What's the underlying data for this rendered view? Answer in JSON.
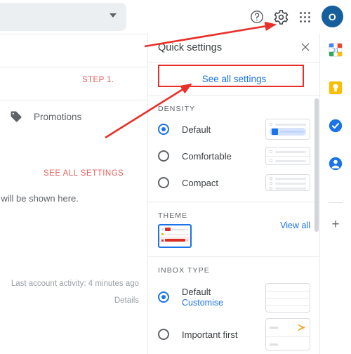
{
  "topbar": {
    "search_placeholder": "",
    "help_icon": "help-circle-icon",
    "settings_icon": "gear-icon",
    "apps_icon": "apps-grid-icon",
    "avatar_letter": "O",
    "avatar_color": "#15609c"
  },
  "left_pane": {
    "step_note": "STEP 1.",
    "tab_label": "Promotions",
    "tab_icon": "tag-icon",
    "see_all_note": "SEE ALL SETTINGS",
    "empty_note": "bs will be shown here.",
    "last_activity": "Last account activity: 4 minutes ago",
    "details_link": "Details"
  },
  "quick_settings": {
    "title": "Quick settings",
    "close_icon": "close-icon",
    "see_all_settings": "See all settings",
    "highlight_color": "#e8302a",
    "accent_color": "#1a73e8",
    "density": {
      "label": "DENSITY",
      "options": [
        {
          "label": "Default",
          "selected": true
        },
        {
          "label": "Comfortable",
          "selected": false
        },
        {
          "label": "Compact",
          "selected": false
        }
      ]
    },
    "theme": {
      "label": "THEME",
      "view_all": "View all"
    },
    "inbox_type": {
      "label": "INBOX TYPE",
      "options": [
        {
          "label": "Default",
          "sub": "Customise",
          "selected": true
        },
        {
          "label": "Important first",
          "sub": "",
          "selected": false
        }
      ]
    }
  },
  "right_rail": {
    "items": [
      {
        "name": "calendar-icon",
        "badge": "31"
      },
      {
        "name": "keep-icon",
        "badge": ""
      },
      {
        "name": "tasks-icon",
        "badge": ""
      },
      {
        "name": "contacts-icon",
        "badge": ""
      }
    ],
    "add_label": "+"
  }
}
